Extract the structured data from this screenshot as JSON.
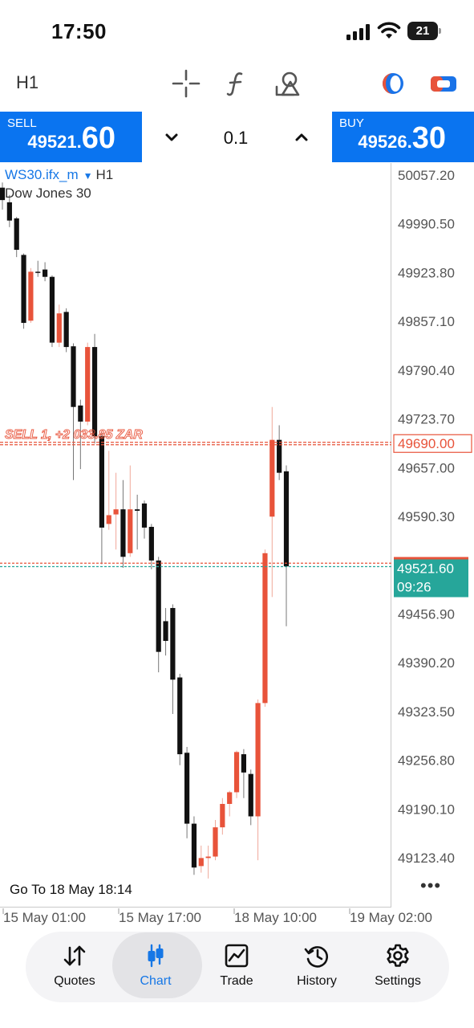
{
  "status_bar": {
    "time": "17:50",
    "battery": "21",
    "icons": [
      "signal-icon",
      "wifi-icon",
      "battery-icon"
    ]
  },
  "toolbar": {
    "timeframe": "H1",
    "icons": [
      "crosshair-icon",
      "indicators-icon",
      "objects-icon",
      "account-icon",
      "one-click-trading-icon"
    ]
  },
  "trade_panel": {
    "sell_label": "SELL",
    "sell_price_main": "49521.",
    "sell_price_big": "60",
    "buy_label": "BUY",
    "buy_price_main": "49526.",
    "buy_price_big": "30",
    "volume": "0.1"
  },
  "chart": {
    "symbol": "WS30.ifx_m",
    "timeframe": "H1",
    "description": "Dow Jones 30",
    "goto_label": "Go To 18 May 18:14",
    "more_icon": "more-dots-icon"
  },
  "chart_data": {
    "type": "candlestick",
    "price_axis_ticks": [
      "50057.20",
      "49990.50",
      "49923.80",
      "49857.10",
      "49790.40",
      "49723.70",
      "49657.00",
      "49590.30",
      "49456.90",
      "49390.20",
      "49323.50",
      "49256.80",
      "49190.10",
      "49123.40"
    ],
    "time_axis_ticks": [
      "15 May 01:00",
      "15 May 17:00",
      "18 May 10:00",
      "19 May 02:00"
    ],
    "ylim": [
      49085,
      50075
    ],
    "position_line": {
      "label": "SELL 1, +2 033.85 ZAR",
      "price": 49690.0,
      "price_label": "49690.00"
    },
    "bid": {
      "price": 49521.6,
      "price_label": "49521.60",
      "countdown": "09:26"
    },
    "ask": {
      "price": 49526.3
    },
    "colors": {
      "bull": "#e8533a",
      "bear": "#111111",
      "bid_tag": "#26a69a",
      "position": "#e8533a"
    },
    "candles": [
      {
        "o": 50040,
        "h": 50047,
        "c": 50023,
        "l": 50010
      },
      {
        "o": 50020,
        "h": 50030,
        "c": 49995,
        "l": 49986
      },
      {
        "o": 49998,
        "h": 50000,
        "c": 49955,
        "l": 49945
      },
      {
        "o": 49948,
        "h": 49950,
        "c": 49855,
        "l": 49847
      },
      {
        "o": 49858,
        "h": 49930,
        "c": 49925,
        "l": 49855
      },
      {
        "o": 49925,
        "h": 49940,
        "c": 49924,
        "l": 49918
      },
      {
        "o": 49928,
        "h": 49938,
        "c": 49918,
        "l": 49912
      },
      {
        "o": 49918,
        "h": 49920,
        "c": 49828,
        "l": 49822
      },
      {
        "o": 49828,
        "h": 49880,
        "c": 49868,
        "l": 49822
      },
      {
        "o": 49870,
        "h": 49875,
        "c": 49822,
        "l": 49815
      },
      {
        "o": 49823,
        "h": 49827,
        "c": 49740,
        "l": 49640
      },
      {
        "o": 49742,
        "h": 49750,
        "c": 49720,
        "l": 49655
      },
      {
        "o": 49720,
        "h": 49828,
        "c": 49822,
        "l": 49715
      },
      {
        "o": 49822,
        "h": 49840,
        "c": 49700,
        "l": 49690
      },
      {
        "o": 49700,
        "h": 49705,
        "c": 49575,
        "l": 49525
      },
      {
        "o": 49580,
        "h": 49680,
        "c": 49592,
        "l": 49572
      },
      {
        "o": 49593,
        "h": 49650,
        "c": 49600,
        "l": 49545
      },
      {
        "o": 49600,
        "h": 49640,
        "c": 49535,
        "l": 49520
      },
      {
        "o": 49540,
        "h": 49660,
        "c": 49600,
        "l": 49535
      },
      {
        "o": 49600,
        "h": 49620,
        "c": 49598,
        "l": 49545
      },
      {
        "o": 49608,
        "h": 49612,
        "c": 49575,
        "l": 49560
      },
      {
        "o": 49576,
        "h": 49580,
        "c": 49530,
        "l": 49518
      },
      {
        "o": 49530,
        "h": 49535,
        "c": 49405,
        "l": 49377
      },
      {
        "o": 49447,
        "h": 49465,
        "c": 49420,
        "l": 49400
      },
      {
        "o": 49465,
        "h": 49470,
        "c": 49367,
        "l": 49320
      },
      {
        "o": 49370,
        "h": 49375,
        "c": 49265,
        "l": 49250
      },
      {
        "o": 49267,
        "h": 49275,
        "c": 49170,
        "l": 49150
      },
      {
        "o": 49170,
        "h": 49180,
        "c": 49110,
        "l": 49100
      },
      {
        "o": 49112,
        "h": 49140,
        "c": 49123,
        "l": 49103
      },
      {
        "o": 49123,
        "h": 49140,
        "c": 49125,
        "l": 49095
      },
      {
        "o": 49125,
        "h": 49175,
        "c": 49165,
        "l": 49120
      },
      {
        "o": 49165,
        "h": 49205,
        "c": 49197,
        "l": 49155
      },
      {
        "o": 49197,
        "h": 49215,
        "c": 49213,
        "l": 49180
      },
      {
        "o": 49213,
        "h": 49270,
        "c": 49268,
        "l": 49205
      },
      {
        "o": 49265,
        "h": 49272,
        "c": 49240,
        "l": 49205
      },
      {
        "o": 49238,
        "h": 49244,
        "c": 49180,
        "l": 49168
      },
      {
        "o": 49180,
        "h": 49340,
        "c": 49335,
        "l": 49120
      },
      {
        "o": 49335,
        "h": 49545,
        "c": 49540,
        "l": 49330
      },
      {
        "o": 49590,
        "h": 49740,
        "c": 49695,
        "l": 49480
      },
      {
        "o": 49695,
        "h": 49715,
        "c": 49650,
        "l": 49640
      },
      {
        "o": 49652,
        "h": 49660,
        "c": 49522,
        "l": 49440
      }
    ]
  },
  "bottom_nav": {
    "items": [
      {
        "label": "Quotes",
        "icon": "quotes-icon"
      },
      {
        "label": "Chart",
        "icon": "chart-icon"
      },
      {
        "label": "Trade",
        "icon": "trade-icon"
      },
      {
        "label": "History",
        "icon": "history-icon"
      },
      {
        "label": "Settings",
        "icon": "settings-icon"
      }
    ],
    "active": "Chart"
  }
}
